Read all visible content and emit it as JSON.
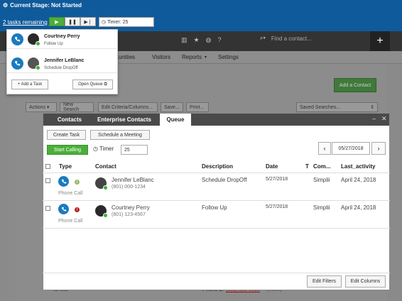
{
  "stage": {
    "title": "Current Stage: Not Started"
  },
  "taskbar": {
    "tasks_remaining": "2 tasks remaining",
    "timer_label": "Timer: 25",
    "colors": {
      "bar": "#0f5a9b",
      "play": "#4caf3a"
    }
  },
  "nav": {
    "search_placeholder": "Find a contact...",
    "menu": [
      "...tunities",
      "Visitors",
      "Reports",
      "Settings"
    ]
  },
  "background": {
    "add_contact": "Add a Contact",
    "toolbar": [
      "Actions",
      "New Search",
      "Edit Criteria/Columns...",
      "Save...",
      "Print...",
      "Saved Searches..."
    ],
    "footer_id": "Id: 159",
    "footer_phone_label": "Phone 1:",
    "footer_phone": "(853) 329-3658",
    "footer_phone_type": "(Work)"
  },
  "tasks_dropdown": {
    "items": [
      {
        "name": "Courtney Perry",
        "desc": "Follow Up"
      },
      {
        "name": "Jennifer LeBlanc",
        "desc": "Schedule DropOff"
      }
    ],
    "add_task": "+ Add a Task",
    "open_queue": "Open Queue"
  },
  "modal": {
    "tabs": [
      "Contacts",
      "Enterprise Contacts",
      "Queue"
    ],
    "create_task": "Create Task",
    "schedule_meeting": "Schedule a Meeting",
    "start_calling": "Start Calling",
    "timer_label": "Timer",
    "timer_value": "25",
    "date": "05/27/2018",
    "columns": [
      "Type",
      "Contact",
      "Description",
      "Date",
      "T",
      "Com...",
      "Last_activity"
    ],
    "rows": [
      {
        "type": "Phone Call",
        "priority": "low",
        "contact_name": "Jennifer LeBlanc",
        "contact_phone": "(801) 000-1234",
        "description": "Schedule DropOff",
        "date": "5/27/2018",
        "company": "Simplii",
        "last_activity": "April 24, 2018"
      },
      {
        "type": "Phone Call",
        "priority": "high",
        "contact_name": "Courtney Perry",
        "contact_phone": "(801) 123-4567",
        "description": "Follow Up",
        "date": "5/27/2018",
        "company": "Simplii",
        "last_activity": "April 24, 2018"
      }
    ],
    "edit_filters": "Edit Filters",
    "edit_columns": "Edit Columns"
  }
}
